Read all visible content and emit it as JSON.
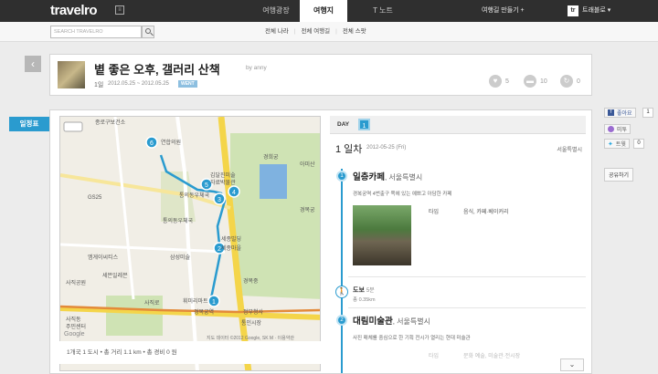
{
  "header": {
    "logo": "travelro",
    "nav": [
      {
        "label": "여행광장"
      },
      {
        "label": "여행지"
      },
      {
        "label": "T 노트"
      }
    ],
    "make_trip": "여행길 만들기 +",
    "user_initial": "tr",
    "user_name": "트래블로 ▾"
  },
  "subheader": {
    "search_placeholder": "SEARCH TRAVELRO",
    "nav": [
      "전체 나라",
      "전체 여행길",
      "전체 스팟"
    ]
  },
  "post": {
    "title": "볕 좋은 오후, 갤러리 산책",
    "author": "by anny",
    "days": "1일",
    "dates": "2012.05.25 ~ 2012.05.25",
    "badge": "WENT",
    "likes": "5",
    "comments": "10",
    "shares": "0"
  },
  "itinerary_tab": "일정표",
  "map": {
    "footer": "1개국 1 도시  •  총 거리 1.1 km  •  총 경비 0 원",
    "labels": [
      "종로구보건소",
      "연합의원",
      "경희궁",
      "아미산",
      "경복궁",
      "김달진미술",
      "자료박물관",
      "통의동우체국",
      "세종빌딩",
      "세종마을",
      "경복중",
      "통의동우체국",
      "삼성미술",
      "GS25",
      "엠게이씨티스",
      "세븐일레븐",
      "사직공원",
      "사직동",
      "주민센터",
      "휘미리마트",
      "사직로",
      "경복궁역",
      "정부청사",
      "통인시장",
      "Google",
      "지도 데이터 ©2012 Google, SK M · 이용약관"
    ],
    "markers": [
      "1",
      "2",
      "3",
      "4",
      "5",
      "6"
    ]
  },
  "day_panel": {
    "day_label": "DAY",
    "day_num": "1",
    "title": "1 일차",
    "date": "2012-05-25 (Fri)",
    "location": "서울특별시"
  },
  "stops": [
    {
      "num": "1",
      "name": "일층카페",
      "city": ", 서울특별시",
      "desc": "경복궁역 4번출구 쪽에 있는 예쁘고 아담한 카페",
      "type_key": "타입",
      "type_val": "음식, 카페·베이커리"
    },
    {
      "num": "2",
      "name": "대림미술관",
      "city": ", 서울특별시",
      "desc": "사진 매체를 중심으로 한 기획 전시가 열리는 현대 미술관",
      "type_key": "타입",
      "type_val": "문화 예술, 미술관·전시장"
    }
  ],
  "walk": {
    "label": "도보",
    "time": "5분",
    "distance": "총 0.35km"
  },
  "social": {
    "like": "좋아요",
    "like_count": "1",
    "me2": "미투",
    "tweet": "트윗",
    "tweet_count": "0",
    "share": "공유하기"
  },
  "colors": {
    "accent": "#2a9bcf",
    "topbar": "#2f2f2f"
  }
}
